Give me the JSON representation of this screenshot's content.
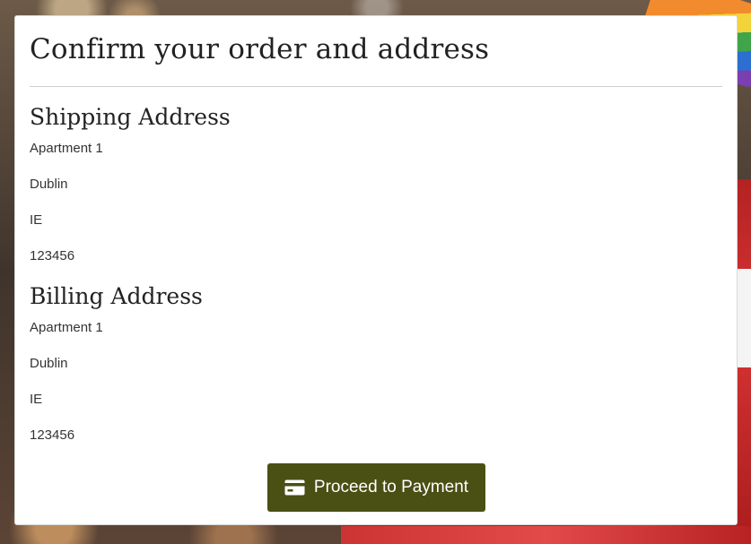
{
  "page": {
    "title": "Confirm your order and address"
  },
  "shipping": {
    "heading": "Shipping Address",
    "lines": [
      "Apartment 1",
      "Dublin",
      "IE",
      "123456"
    ]
  },
  "billing": {
    "heading": "Billing Address",
    "lines": [
      "Apartment 1",
      "Dublin",
      "IE",
      "123456"
    ]
  },
  "actions": {
    "proceed_label": "Proceed to Payment",
    "proceed_icon": "credit-card-icon",
    "button_color": "#4a4f14"
  }
}
